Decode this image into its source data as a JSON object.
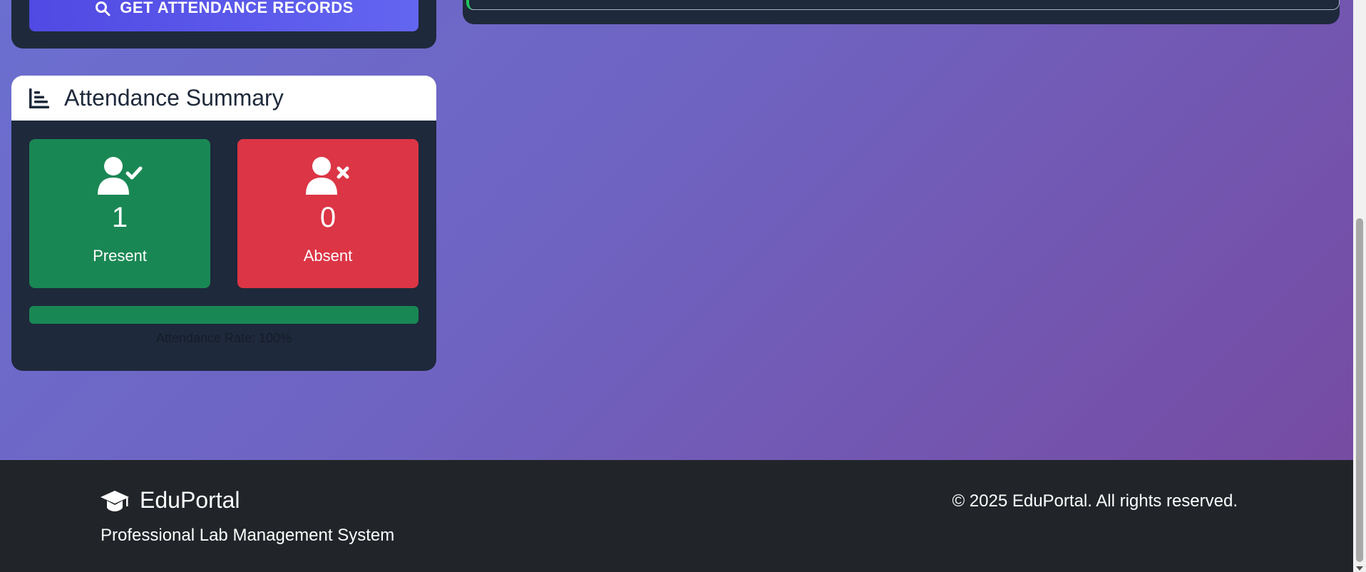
{
  "actions": {
    "get_records_label": "GET ATTENDANCE RECORDS"
  },
  "summary": {
    "title": "Attendance Summary",
    "present": {
      "count": "1",
      "label": "Present"
    },
    "absent": {
      "count": "0",
      "label": "Absent"
    },
    "attendance_rate": 1.0,
    "rate_text": "Attendance Rate: 100%"
  },
  "footer": {
    "brand": "EduPortal",
    "tagline": "Professional Lab Management System",
    "copyright": "© 2025 EduPortal. All rights reserved."
  },
  "icons": {
    "search": "search-icon",
    "chart": "chart-bar-icon",
    "present": "user-check-icon",
    "absent": "user-xmark-icon",
    "brand": "graduation-cap-icon"
  },
  "colors": {
    "present": "#198754",
    "absent": "#dc3545",
    "card": "#1e293b",
    "button": "#5b5ee9",
    "footer": "#212529"
  }
}
